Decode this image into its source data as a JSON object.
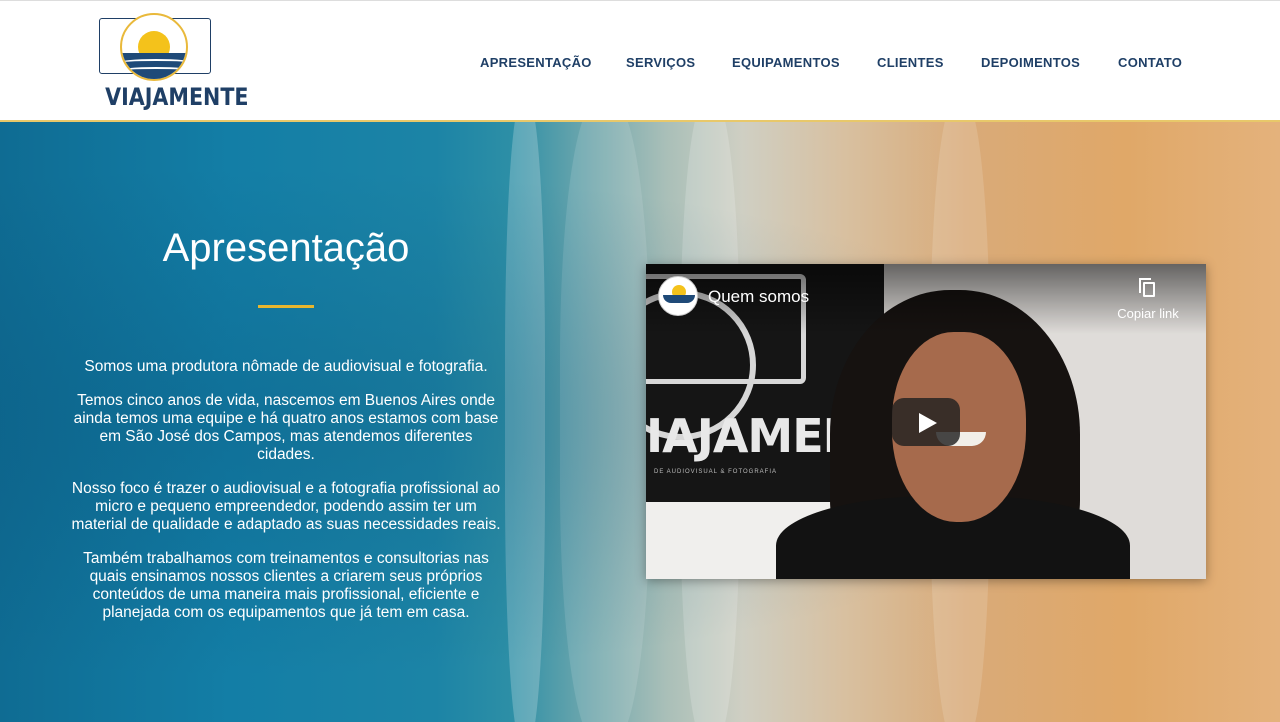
{
  "brand": {
    "logo_text": "VIAJAMENTE",
    "colors": {
      "navy": "#1f3f66",
      "gold": "#e8b62e",
      "sun": "#f4c21b"
    }
  },
  "nav": {
    "items": [
      {
        "label": "APRESENTAÇÃO"
      },
      {
        "label": "SERVIÇOS"
      },
      {
        "label": "EQUIPAMENTOS"
      },
      {
        "label": "CLIENTES"
      },
      {
        "label": "DEPOIMENTOS"
      },
      {
        "label": "CONTATO"
      }
    ]
  },
  "intro": {
    "title": "Apresentação",
    "paragraphs": [
      "Somos uma produtora nômade de audiovisual e fotografia.",
      "Temos cinco anos de vida, nascemos em Buenos Aires onde ainda temos uma equipe e há quatro anos estamos com base em São José dos Campos, mas atendemos diferentes cidades.",
      "Nosso foco é trazer o audiovisual e a fotografia profissional ao micro e pequeno empreendedor, podendo assim ter um material de qualidade e adaptado as suas necessidades reais.",
      "Também trabalhamos com treinamentos e consultorias nas quais ensinamos nossos clientes a criarem seus próprios conteúdos de uma maneira mais profissional, eficiente e planejada com os equipamentos que já tem em casa."
    ]
  },
  "video": {
    "title": "Quem somos",
    "copy_link_label": "Copiar link",
    "thumbnail_banner_text": "IAJAMENTE",
    "thumbnail_banner_subtext": "DE AUDIOVISUAL & FOTOGRAFIA",
    "icons": {
      "play": "play-icon",
      "copy": "copy-link-icon"
    }
  }
}
